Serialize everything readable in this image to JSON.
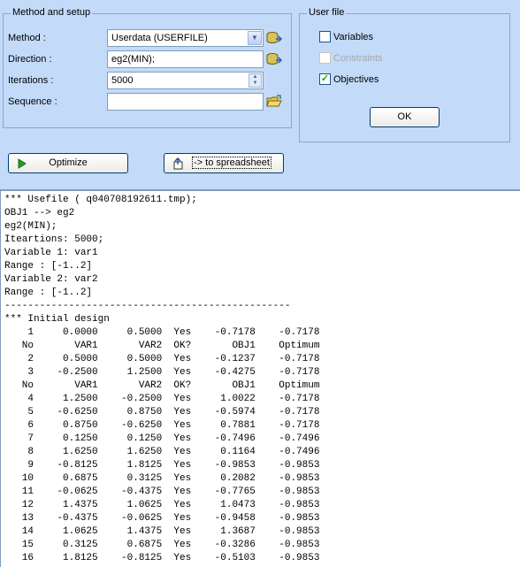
{
  "method_group": {
    "title": "Method and setup",
    "method_label": "Method :",
    "method_value": "Userdata (USERFILE)",
    "direction_label": "Direction :",
    "direction_value": "eg2(MIN);",
    "iterations_label": "Iterations :",
    "iterations_value": "5000",
    "sequence_label": "Sequence :",
    "sequence_value": ""
  },
  "user_file_group": {
    "title": "User file",
    "variables_label": "Variables",
    "variables_checked": false,
    "constraints_label": "Constraints",
    "constraints_checked": false,
    "constraints_disabled": true,
    "objectives_label": "Objectives",
    "objectives_checked": true,
    "ok_label": "OK"
  },
  "actions": {
    "optimize_label": "Optimize",
    "spreadsheet_label": "-> to spreadsheet"
  },
  "output_lines": [
    "*** Usefile ( q040708192611.tmp);",
    "OBJ1 --> eg2",
    "eg2(MIN);",
    "Iteartions: 5000;",
    "Variable 1: var1",
    "Range : [-1..2]",
    "Variable 2: var2",
    "Range : [-1..2]",
    "-------------------------------------------------",
    "*** Initial design",
    "    1     0.0000     0.5000  Yes    -0.7178    -0.7178",
    "   No       VAR1       VAR2  OK?       OBJ1    Optimum",
    "    2     0.5000     0.5000  Yes    -0.1237    -0.7178",
    "    3    -0.2500     1.2500  Yes    -0.4275    -0.7178",
    "   No       VAR1       VAR2  OK?       OBJ1    Optimum",
    "    4     1.2500    -0.2500  Yes     1.0022    -0.7178",
    "    5    -0.6250     0.8750  Yes    -0.5974    -0.7178",
    "    6     0.8750    -0.6250  Yes     0.7881    -0.7178",
    "    7     0.1250     0.1250  Yes    -0.7496    -0.7496",
    "    8     1.6250     1.6250  Yes     0.1164    -0.7496",
    "    9    -0.8125     1.8125  Yes    -0.9853    -0.9853",
    "   10     0.6875     0.3125  Yes     0.2082    -0.9853",
    "   11    -0.0625    -0.4375  Yes    -0.7765    -0.9853",
    "   12     1.4375     1.0625  Yes     1.0473    -0.9853",
    "   13    -0.4375    -0.0625  Yes    -0.9458    -0.9853",
    "   14     1.0625     1.4375  Yes     1.3687    -0.9853",
    "   15     0.3125     0.6875  Yes    -0.3286    -0.9853",
    "   16     1.8125    -0.8125  Yes    -0.5103    -0.9853"
  ]
}
